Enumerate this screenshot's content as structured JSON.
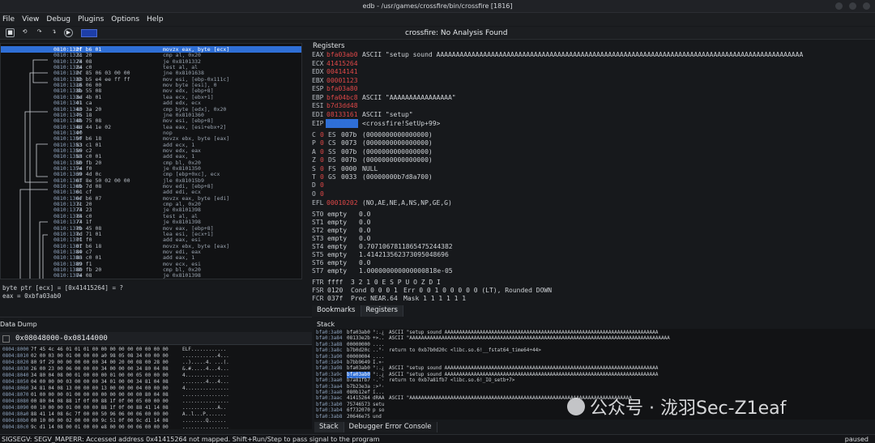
{
  "window": {
    "title": "edb - /usr/games/crossfire/bin/crossfire [1816]"
  },
  "menu": [
    "File",
    "View",
    "Debug",
    "Plugins",
    "Options",
    "Help"
  ],
  "toolbar": {
    "status": "crossfire: No Analysis Found"
  },
  "disasm": {
    "rows": [
      {
        "addr": "0810:132f",
        "bytes": "0f b6 01",
        "ins": "movzx eax, byte [ecx]"
      },
      {
        "addr": "0810:1323",
        "bytes": "3c 20",
        "ins": "cmp al, 0x20"
      },
      {
        "addr": "0810:1328",
        "bytes": "74 08",
        "ins": "je 0x8101332"
      },
      {
        "addr": "0810:132a",
        "bytes": "84 c0",
        "ins": "test al, al"
      },
      {
        "addr": "0810:132c",
        "bytes": "0f 85 06 03 00 00",
        "ins": "jne 0x8101638"
      },
      {
        "addr": "0810:1332",
        "bytes": "8b b5 e4 ee ff ff",
        "ins": "mov esi, [ebp-0x111c]"
      },
      {
        "addr": "0810:1338",
        "bytes": "c6 06 00",
        "ins": "mov byte [esi], 0"
      },
      {
        "addr": "0810:133b",
        "bytes": "8b 55 08",
        "ins": "mov edx, [ebp+8]"
      },
      {
        "addr": "0810:133e",
        "bytes": "8d 4b 01",
        "ins": "lea ecx, [ebx+1]"
      },
      {
        "addr": "0810:1341",
        "bytes": "01 ca",
        "ins": "add edx, ecx"
      },
      {
        "addr": "0810:1343",
        "bytes": "80 3a 20",
        "ins": "cmp byte [edx], 0x20"
      },
      {
        "addr": "0810:1346",
        "bytes": "75 18",
        "ins": "jne 0x8101360"
      },
      {
        "addr": "0810:1348",
        "bytes": "8b 75 08",
        "ins": "mov esi, [ebp+8]"
      },
      {
        "addr": "0810:134b",
        "bytes": "8d 44 1e 02",
        "ins": "lea eax, [esi+ebx+2]"
      },
      {
        "addr": "0810:134f",
        "bytes": "90",
        "ins": "nop"
      },
      {
        "addr": "0810:1350",
        "bytes": "0f b6 18",
        "ins": "movzx ebx, byte [eax]"
      },
      {
        "addr": "0810:1353",
        "bytes": "83 c1 01",
        "ins": "add ecx, 1"
      },
      {
        "addr": "0810:1356",
        "bytes": "89 c2",
        "ins": "mov edx, eax"
      },
      {
        "addr": "0810:1358",
        "bytes": "83 c0 01",
        "ins": "add eax, 1"
      },
      {
        "addr": "0810:135b",
        "bytes": "80 fb 20",
        "ins": "cmp bl, 0x20"
      },
      {
        "addr": "0810:135e",
        "bytes": "74 f0",
        "ins": "je 0x8101350"
      },
      {
        "addr": "0810:1360",
        "bytes": "39 4d 0c",
        "ins": "cmp [ebp+0xc], ecx"
      },
      {
        "addr": "0810:1363",
        "bytes": "0f 8e 50 02 00 00",
        "ins": "jle 0x81015b9"
      },
      {
        "addr": "0810:1369",
        "bytes": "8b 7d 08",
        "ins": "mov edi, [ebp+8]"
      },
      {
        "addr": "0810:136c",
        "bytes": "01 cf",
        "ins": "add edi, ecx"
      },
      {
        "addr": "0810:136e",
        "bytes": "0f b6 07",
        "ins": "movzx eax, byte [edi]"
      },
      {
        "addr": "0810:1371",
        "bytes": "3c 20",
        "ins": "cmp al, 0x20"
      },
      {
        "addr": "0810:1373",
        "bytes": "74 23",
        "ins": "je 0x8101398"
      },
      {
        "addr": "0810:1375",
        "bytes": "84 c0",
        "ins": "test al, al"
      },
      {
        "addr": "0810:1377",
        "bytes": "74 1f",
        "ins": "je 0x8101398"
      },
      {
        "addr": "0810:1379",
        "bytes": "8b 45 08",
        "ins": "mov eax, [ebp+8]"
      },
      {
        "addr": "0810:137c",
        "bytes": "8d 71 01",
        "ins": "lea esi, [ecx+1]"
      },
      {
        "addr": "0810:137f",
        "bytes": "01 f0",
        "ins": "add eax, esi"
      },
      {
        "addr": "0810:1381",
        "bytes": "0f b6 18",
        "ins": "movzx ebx, byte [eax]"
      },
      {
        "addr": "0810:1384",
        "bytes": "89 c7",
        "ins": "mov edi, eax"
      },
      {
        "addr": "0810:1386",
        "bytes": "83 c0 01",
        "ins": "add eax, 1"
      },
      {
        "addr": "0810:1389",
        "bytes": "89 f1",
        "ins": "mov ecx, esi"
      },
      {
        "addr": "0810:138b",
        "bytes": "80 fb 20",
        "ins": "cmp bl, 0x20"
      },
      {
        "addr": "0810:138e",
        "bytes": "74 08",
        "ins": "je 0x8101398"
      }
    ]
  },
  "expr": {
    "line1": "byte ptr [ecx] = [0x41415264] = ?",
    "line2": "eax = 0xbfa03ab0"
  },
  "datadump": {
    "title": "Data Dump",
    "tab": "0x08048000-0x08144000",
    "rows": [
      {
        "a": "0804:8000",
        "h": "7f 45 4c 46 01 01 01 00 00 00 00 00 00 00 00 00",
        "s": "ELF............"
      },
      {
        "a": "0804:8010",
        "h": "02 00 03 00 01 00 00 00 a0 98 05 08 34 00 00 00",
        "s": "............4..."
      },
      {
        "a": "0804:8020",
        "h": "80 9f 29 00 00 00 00 00 34 00 20 00 08 00 28 00",
        "s": "..).....4. ...(."
      },
      {
        "a": "0804:8030",
        "h": "26 00 23 00 06 00 00 00 34 00 00 00 34 80 04 08",
        "s": "&.#.....4...4..."
      },
      {
        "a": "0804:8040",
        "h": "34 80 04 08 00 01 00 00 00 01 00 00 05 00 00 00",
        "s": "4..............."
      },
      {
        "a": "0804:8050",
        "h": "04 00 00 00 03 00 00 00 34 01 00 00 34 81 04 08",
        "s": "........4...4..."
      },
      {
        "a": "0804:8060",
        "h": "34 81 04 08 13 00 00 00 13 00 00 00 04 00 00 00",
        "s": "4..............."
      },
      {
        "a": "0804:8070",
        "h": "01 00 00 00 01 00 00 00 00 00 00 00 00 80 04 08",
        "s": "................"
      },
      {
        "a": "0804:8080",
        "h": "00 80 04 08 88 1f 0f 00 88 1f 0f 00 05 00 00 00",
        "s": "................"
      },
      {
        "a": "0804:8090",
        "h": "00 10 00 00 01 00 00 00 88 1f 0f 00 88 41 14 08",
        "s": "............A.."
      },
      {
        "a": "0804:80a0",
        "h": "88 41 14 08 6c 7f 00 00 50 96 06 00 06 00 00 00",
        "s": "A..l...P......."
      },
      {
        "a": "0804:80b0",
        "h": "00 10 00 00 02 00 00 00 9c 51 0f 00 9c d1 14 08",
        "s": "........Q......"
      },
      {
        "a": "0804:80c0",
        "h": "9c d1 14 08 00 01 00 00 e8 00 00 00 06 00 00 00",
        "s": "................"
      }
    ]
  },
  "registers": {
    "header": "Registers",
    "gp": [
      {
        "n": "EAX",
        "v": "bfa03ab0",
        "c": "ASCII \"setup sound AAAAAAAAAAAAAAAAAAAAAAAAAAAAAAAAAAAAAAAAAAAAAAAAAAAAAAAAAAAAAAAAAAAAAAAAAAAAAAAAAAAAAAAAAAAAAA"
      },
      {
        "n": "ECX",
        "v": "41415264",
        "c": ""
      },
      {
        "n": "EDX",
        "v": "00414141",
        "c": ""
      },
      {
        "n": "EBX",
        "v": "00001123",
        "c": ""
      },
      {
        "n": "ESP",
        "v": "bfa03a80",
        "c": ""
      },
      {
        "n": "EBP",
        "v": "bfa04bc8",
        "c": "ASCII \"AAAAAAAAAAAAAAAA\""
      },
      {
        "n": "ESI",
        "v": "b7d3dd48",
        "c": ""
      },
      {
        "n": "EDI",
        "v": "08133161",
        "c": "ASCII \"setup\""
      }
    ],
    "eip": {
      "n": "EIP",
      "v": "08101323",
      "c": "<crossfire!SetUp+99>"
    },
    "flags": [
      {
        "f": "C",
        "fv": "0",
        "s": "ES",
        "sv": "007b",
        "d": "(0000000000000000)"
      },
      {
        "f": "P",
        "fv": "0",
        "s": "CS",
        "sv": "0073",
        "d": "(0000000000000000)"
      },
      {
        "f": "A",
        "fv": "0",
        "s": "SS",
        "sv": "007b",
        "d": "(0000000000000000)"
      },
      {
        "f": "Z",
        "fv": "0",
        "s": "DS",
        "sv": "007b",
        "d": "(0000000000000000)"
      },
      {
        "f": "S",
        "fv": "0",
        "s": "FS",
        "sv": "0000",
        "d": "NULL"
      },
      {
        "f": "T",
        "fv": "0",
        "s": "GS",
        "sv": "0033",
        "d": "(00000000b7d8a700)"
      },
      {
        "f": "D",
        "fv": "0",
        "s": "",
        "sv": "",
        "d": ""
      },
      {
        "f": "O",
        "fv": "0",
        "s": "",
        "sv": "",
        "d": ""
      }
    ],
    "efl": {
      "n": "EFL",
      "v": "00010202",
      "c": "(NO,AE,NE,A,NS,NP,GE,G)"
    },
    "fpu": [
      {
        "n": "ST0",
        "e": "empty",
        "v": "0.0"
      },
      {
        "n": "ST1",
        "e": "empty",
        "v": "0.0"
      },
      {
        "n": "ST2",
        "e": "empty",
        "v": "0.0"
      },
      {
        "n": "ST3",
        "e": "empty",
        "v": "0.0"
      },
      {
        "n": "ST4",
        "e": "empty",
        "v": "0.7071067811865475244382"
      },
      {
        "n": "ST5",
        "e": "empty",
        "v": "1.414213562373095048696"
      },
      {
        "n": "ST6",
        "e": "empty",
        "v": "0.0"
      },
      {
        "n": "ST7",
        "e": "empty",
        "v": "1.000000000000000818e-05"
      }
    ],
    "ftr": {
      "n": "FTR",
      "v": "ffff",
      "bits": "3 2 1 0      E S P U O Z D I"
    },
    "fsr": {
      "n": "FSR",
      "v": "0120",
      "cond": "Cond  0 0 0 1",
      "err": "Err  0 0 1 0 0 0 0 0  (LT), Rounded DOWN"
    },
    "fcr": {
      "n": "FCR",
      "v": "037f",
      "prec": "Prec  NEAR,64",
      "mask": "Mask       1 1 1 1 1 1"
    }
  },
  "midtabs": [
    "Bookmarks",
    "Registers"
  ],
  "stack": {
    "title": "Stack",
    "rows": [
      {
        "a": "bfa0:3a80",
        "v": "bfa03ab0",
        "a2": "°:.¿",
        "c": "ASCII \"setup sound AAAAAAAAAAAAAAAAAAAAAAAAAAAAAAAAAAAAAAAAAAAAAAAAAAAAAAAAAAAAAAAAAAAAAAAAA"
      },
      {
        "a": "bfa0:3a84",
        "v": "08133e2b",
        "a2": "+>..",
        "c": "ASCII \"AAAAAAAAAAAAAAAAAAAAAAAAAAAAAAAAAAAAAAAAAAAAAAAAAAAAAAAAAAAAAAAAAAAAAAAAAAAAAAAAAAAAAAAAA"
      },
      {
        "a": "bfa0:3a88",
        "v": "00000000",
        "a2": "....",
        "c": ""
      },
      {
        "a": "bfa0:3a8c",
        "v": "b7b0d20c",
        "a2": "..°·",
        "c": "return to 0xb7b0d20c <libc.so.6!__fstat64_time64+44>"
      },
      {
        "a": "bfa0:3a90",
        "v": "00000004",
        "a2": "....",
        "c": ""
      },
      {
        "a": "bfa0:3a94",
        "v": "b7bb9649",
        "a2": "I.»·",
        "c": ""
      },
      {
        "a": "bfa0:3a98",
        "v": "bfa03ab0",
        "a2": "°:.¿",
        "c": "ASCII \"setup sound AAAAAAAAAAAAAAAAAAAAAAAAAAAAAAAAAAAAAAAAAAAAAAAAAAAAAAAAAAAAAAAAAAAAAAAAA"
      },
      {
        "a": "bfa0:3a9c",
        "v": "bfa03ab0",
        "a2": "°:.¿",
        "c": "ASCII \"setup sound AAAAAAAAAAAAAAAAAAAAAAAAAAAAAAAAAAAAAAAAAAAAAAAAAAAAAAAAAAAAAAAAAAAAAAAAA"
      },
      {
        "a": "bfa0:3aa0",
        "v": "b7a81fb7",
        "a2": "·.¨·",
        "c": "return to 0xb7a81fb7 <libc.so.6!_IO_setb+7>"
      },
      {
        "a": "bfa0:3aa4",
        "v": "b7b23e3a",
        "a2": ":>²·",
        "c": ""
      },
      {
        "a": "bfa0:3aa8",
        "v": "080b12ef",
        "a2": "ï...",
        "c": ""
      },
      {
        "a": "bfa0:3aac",
        "v": "41415264",
        "a2": "dRAA",
        "c": "ASCII \"AAAAAAAAAAAAAAAAAAAAAAAAAAAAAAAAAAAAAAAAAAAAAAAAAAAAAAAAAAAAAAAAAAAAAAAAAAAA"
      },
      {
        "a": "bfa0:3ab0",
        "v": "75746573",
        "a2": "setu",
        "c": ""
      },
      {
        "a": "bfa0:3ab4",
        "v": "6f732070",
        "a2": "p so",
        "c": ""
      },
      {
        "a": "bfa0:3ab8",
        "v": "20646e75",
        "a2": "und ",
        "c": ""
      }
    ]
  },
  "bottomtabs": [
    "Stack",
    "Debugger Error Console"
  ],
  "status": {
    "message": "SIGSEGV: SEGV_MAPERR: Accessed address 0x41415264 not mapped. Shift+Run/Step to pass signal to the program",
    "state": "paused"
  },
  "watermark": {
    "text": "公众号 · 泷羽Sec-Z1eaf"
  }
}
